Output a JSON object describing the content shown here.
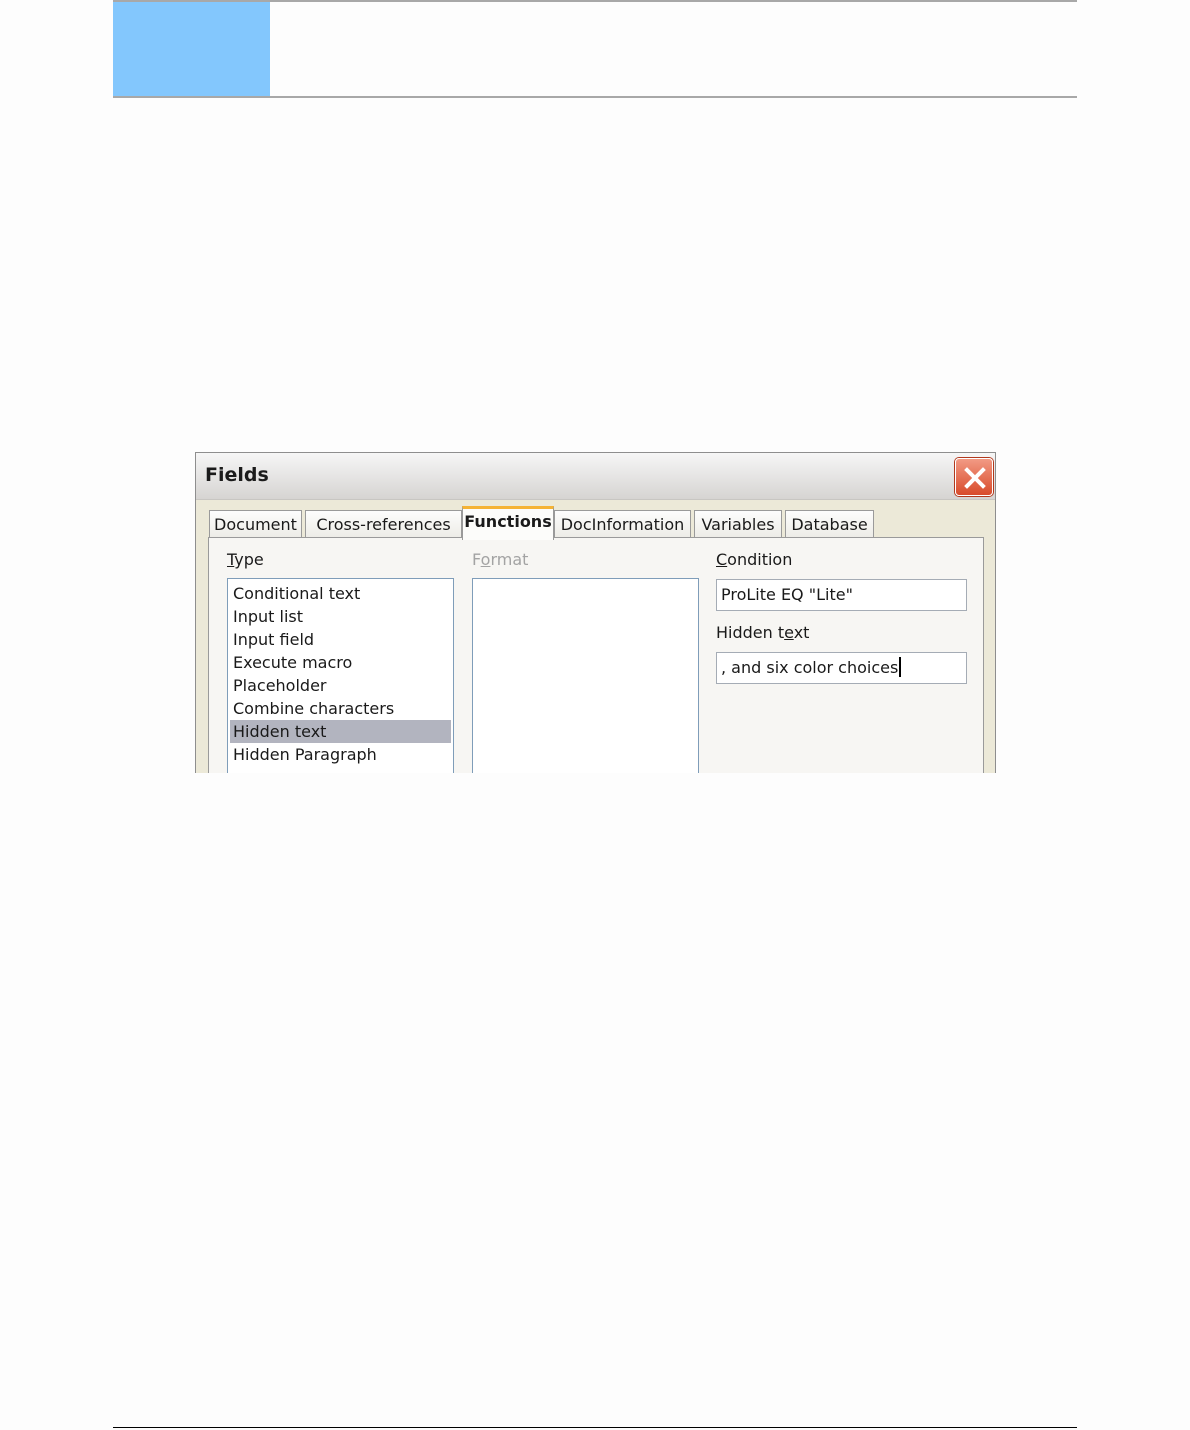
{
  "dialog": {
    "title": "Fields",
    "close_icon": "close-x-icon",
    "tabs": [
      {
        "label": "Document"
      },
      {
        "label": "Cross-references"
      },
      {
        "label": "Functions",
        "active": true
      },
      {
        "label": "DocInformation"
      },
      {
        "label": "Variables"
      },
      {
        "label": "Database"
      }
    ],
    "type_label_accel": "T",
    "type_label_rest": "ype",
    "format_label_pre": "F",
    "format_label_accel": "o",
    "format_label_rest": "rmat",
    "condition_label_accel": "C",
    "condition_label_rest": "ondition",
    "hidden_text_label_pre": "Hidden t",
    "hidden_text_label_accel": "e",
    "hidden_text_label_rest": "xt",
    "type_items": [
      {
        "label": "Conditional text"
      },
      {
        "label": "Input list"
      },
      {
        "label": "Input field"
      },
      {
        "label": "Execute macro"
      },
      {
        "label": "Placeholder"
      },
      {
        "label": "Combine characters"
      },
      {
        "label": "Hidden text",
        "selected": true
      },
      {
        "label": "Hidden Paragraph"
      }
    ],
    "condition_value": "ProLite EQ \"Lite\"",
    "hidden_text_value": ", and six color choices"
  },
  "colors": {
    "header_accent": "#83c7fd",
    "tab_active_highlight": "#f5b335",
    "selection": "#b2b4bf",
    "close_button": "#d84b2b"
  }
}
